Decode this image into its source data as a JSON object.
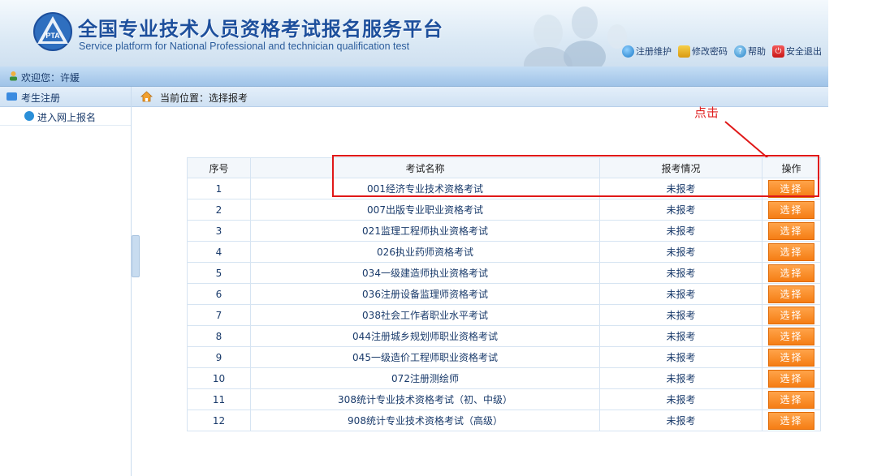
{
  "header": {
    "title_cn": "全国专业技术人员资格考试报名服务平台",
    "title_en": "Service platform for National Professional and technician qualification test",
    "logo_text": "PTA",
    "links": [
      {
        "label": "注册维护",
        "icon": "globe-icon",
        "color": "#2a8fd8"
      },
      {
        "label": "修改密码",
        "icon": "lock-icon",
        "color": "#e0a21c"
      },
      {
        "label": "帮助",
        "icon": "help-icon",
        "color": "#3a9ad9"
      },
      {
        "label": "安全退出",
        "icon": "power-icon",
        "color": "#e02b2b"
      }
    ]
  },
  "welcome": {
    "label": "欢迎您：",
    "user": "许媛"
  },
  "sidebar": {
    "section_title": "考生注册",
    "items": [
      {
        "label": "进入网上报名"
      }
    ]
  },
  "breadcrumb": {
    "text": "当前位置：选择报考"
  },
  "annotation": {
    "text": "点击",
    "color": "#e02020"
  },
  "table": {
    "headers": [
      "序号",
      "考试名称",
      "报考情况",
      "操作"
    ],
    "button_label": "选择",
    "rows": [
      {
        "no": "1",
        "name": "001经济专业技术资格考试",
        "status": "未报考"
      },
      {
        "no": "2",
        "name": "007出版专业职业资格考试",
        "status": "未报考"
      },
      {
        "no": "3",
        "name": "021监理工程师执业资格考试",
        "status": "未报考"
      },
      {
        "no": "4",
        "name": "026执业药师资格考试",
        "status": "未报考"
      },
      {
        "no": "5",
        "name": "034一级建造师执业资格考试",
        "status": "未报考"
      },
      {
        "no": "6",
        "name": "036注册设备监理师资格考试",
        "status": "未报考"
      },
      {
        "no": "7",
        "name": "038社会工作者职业水平考试",
        "status": "未报考"
      },
      {
        "no": "8",
        "name": "044注册城乡规划师职业资格考试",
        "status": "未报考"
      },
      {
        "no": "9",
        "name": "045一级造价工程师职业资格考试",
        "status": "未报考"
      },
      {
        "no": "10",
        "name": "072注册测绘师",
        "status": "未报考"
      },
      {
        "no": "11",
        "name": "308统计专业技术资格考试（初、中级）",
        "status": "未报考"
      },
      {
        "no": "12",
        "name": "908统计专业技术资格考试（高级）",
        "status": "未报考"
      }
    ]
  },
  "colors": {
    "accent": "#1d4f9c",
    "button": "#f57d14",
    "highlight": "#e01818"
  }
}
